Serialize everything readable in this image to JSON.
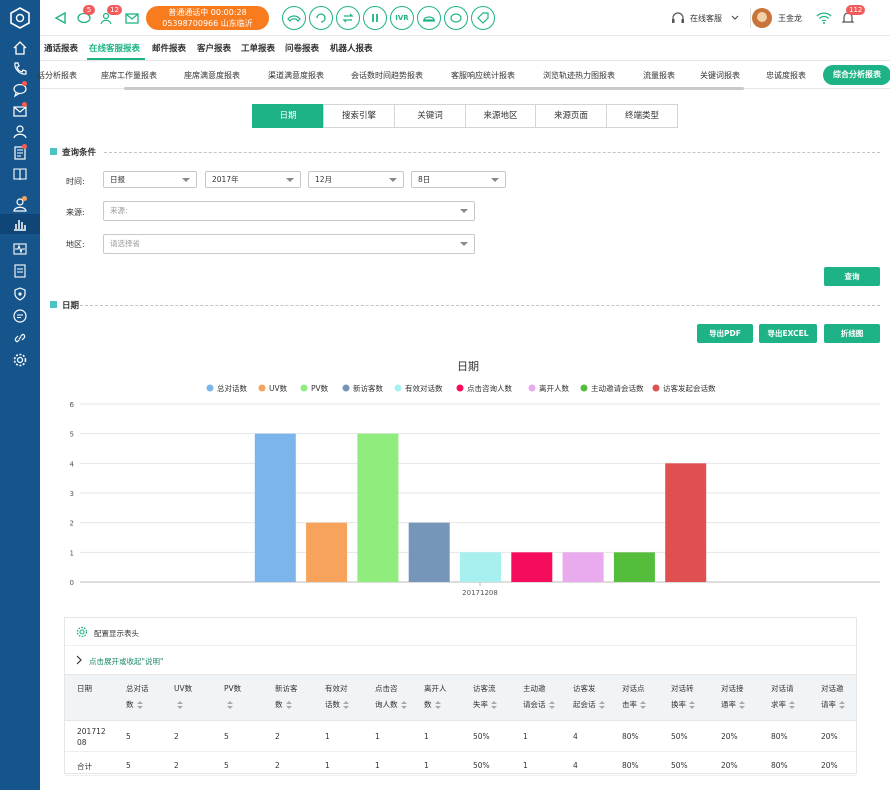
{
  "topbar": {
    "badges": {
      "chat": "5",
      "queue": "12",
      "alerts": "112"
    },
    "call_status": "普通通话中  00:00:28",
    "call_number": "05398700966 山东临沂",
    "ivr_label": "IVR",
    "agent_status": "在线客服",
    "user_name": "王金龙"
  },
  "menu": {
    "items": [
      "通话报表",
      "在线客服报表",
      "邮件报表",
      "客户报表",
      "工单报表",
      "问卷报表",
      "机器人报表"
    ],
    "active": "在线客服报表"
  },
  "subtabs": {
    "items": [
      "话分析报表",
      "座席工作量报表",
      "座席满意度报表",
      "渠道满意度报表",
      "会话数时间趋势报表",
      "客服响应统计报表",
      "浏览轨迹热力图报表",
      "流量报表",
      "关键词报表",
      "忠诚度报表",
      "综合分析报表"
    ],
    "active": "综合分析报表"
  },
  "segments": {
    "items": [
      "日期",
      "搜索引擎",
      "关键词",
      "来源地区",
      "来源页面",
      "终端类型"
    ],
    "active": "日期"
  },
  "query": {
    "section_title": "查询条件",
    "time_label": "时间:",
    "period": "日报",
    "year": "2017年",
    "month": "12月",
    "day": "8日",
    "source_label": "来源:",
    "source_placeholder": "来源:",
    "region_label": "地区:",
    "region_placeholder": "请选择省",
    "query_button": "查询"
  },
  "result": {
    "section_title": "日期",
    "export_pdf": "导出PDF",
    "export_excel": "导出EXCEL",
    "line_chart": "折线图"
  },
  "chart_data": {
    "type": "bar",
    "title": "日期",
    "categories": [
      "20171208"
    ],
    "series": [
      {
        "name": "总对话数",
        "values": [
          5
        ],
        "color": "#7cb5ec"
      },
      {
        "name": "UV数",
        "values": [
          2
        ],
        "color": "#f7a35c"
      },
      {
        "name": "PV数",
        "values": [
          5
        ],
        "color": "#90ed7d"
      },
      {
        "name": "新访客数",
        "values": [
          2
        ],
        "color": "#7696b9"
      },
      {
        "name": "有效对话数",
        "values": [
          1
        ],
        "color": "#a8efef"
      },
      {
        "name": "点击咨询人数",
        "values": [
          1
        ],
        "color": "#f50c5c"
      },
      {
        "name": "离开人数",
        "values": [
          1
        ],
        "color": "#eaaaee"
      },
      {
        "name": "主动邀请会话数",
        "values": [
          1
        ],
        "color": "#54be3c"
      },
      {
        "name": "访客发起会话数",
        "values": [
          4
        ],
        "color": "#e05050"
      }
    ],
    "yticks": [
      "0",
      "1",
      "2",
      "3",
      "4",
      "5",
      "6"
    ],
    "ylim": [
      0,
      6
    ],
    "legend": "top-center",
    "grid": true
  },
  "config": {
    "label": "配置显示表头",
    "toggle_note": "点击展开或收起\"说明\""
  },
  "table": {
    "headers": [
      {
        "line1": "日期",
        "line2": ""
      },
      {
        "line1": "总对话",
        "line2": "数"
      },
      {
        "line1": "UV数",
        "line2": ""
      },
      {
        "line1": "PV数",
        "line2": ""
      },
      {
        "line1": "新访客",
        "line2": "数"
      },
      {
        "line1": "有效对",
        "line2": "话数"
      },
      {
        "line1": "点击咨",
        "line2": "询人数"
      },
      {
        "line1": "离开人",
        "line2": "数"
      },
      {
        "line1": "访客流",
        "line2": "失率"
      },
      {
        "line1": "主动邀",
        "line2": "请会话"
      },
      {
        "line1": "访客发",
        "line2": "起会话"
      },
      {
        "line1": "对话点",
        "line2": "击率"
      },
      {
        "line1": "对话转",
        "line2": "换率"
      },
      {
        "line1": "对话接",
        "line2": "通率"
      },
      {
        "line1": "对话请",
        "line2": "求率"
      },
      {
        "line1": "对话邀",
        "line2": "请率"
      }
    ],
    "rows": [
      {
        "date_line1": "201712",
        "date_line2": "08",
        "cells": [
          "5",
          "2",
          "5",
          "2",
          "1",
          "1",
          "1",
          "50%",
          "1",
          "4",
          "80%",
          "50%",
          "20%",
          "80%",
          "20%"
        ]
      },
      {
        "date_line1": "合计",
        "date_line2": "",
        "cells": [
          "5",
          "2",
          "5",
          "2",
          "1",
          "1",
          "1",
          "50%",
          "1",
          "4",
          "80%",
          "50%",
          "20%",
          "80%",
          "20%"
        ]
      }
    ]
  }
}
